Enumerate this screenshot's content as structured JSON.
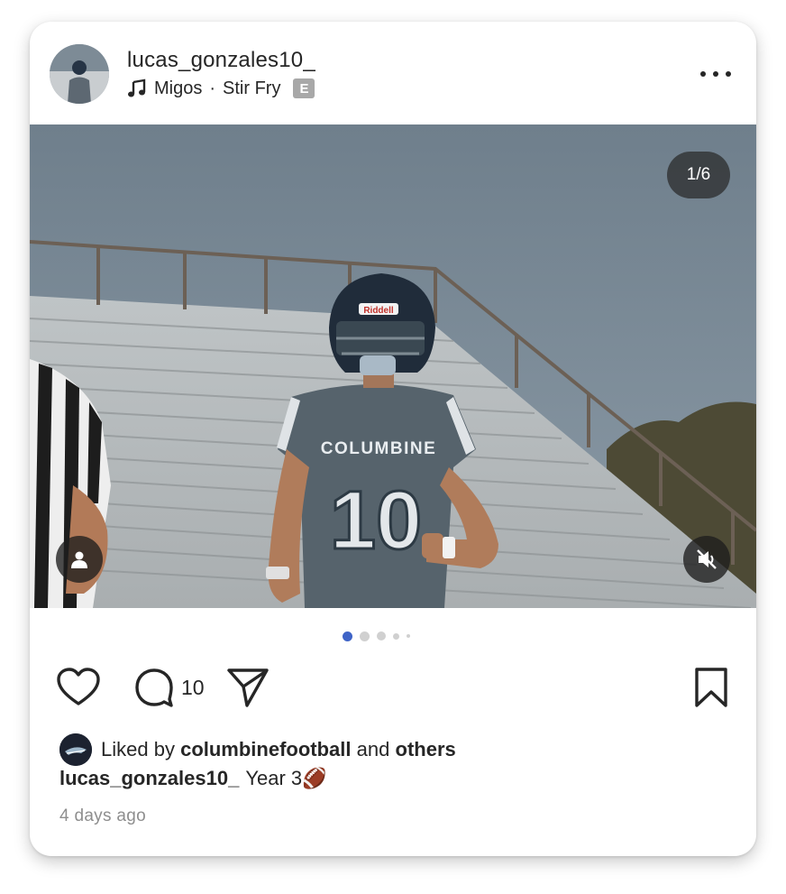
{
  "post": {
    "username": "lucas_gonzales10_",
    "music": {
      "artist": "Migos",
      "separator": "·",
      "song": "Stir Fry",
      "explicit_label": "E"
    },
    "media": {
      "counter": "1/6",
      "current_index": 1,
      "total": 6
    },
    "actions": {
      "comment_count": "10"
    },
    "likes": {
      "prefix": "Liked by",
      "user": "columbinefootball",
      "conjunction": "and",
      "others": "others"
    },
    "caption": {
      "username": "lucas_gonzales10_",
      "text": "Year 3🏈"
    },
    "timestamp": "4 days ago"
  },
  "photo_text": {
    "jersey_team": "COLUMBINE",
    "jersey_number": "10",
    "helmet_brand": "Riddell"
  },
  "colors": {
    "active_dot": "#3f64c7",
    "text": "#262626",
    "muted_text": "#8e8e8e"
  }
}
